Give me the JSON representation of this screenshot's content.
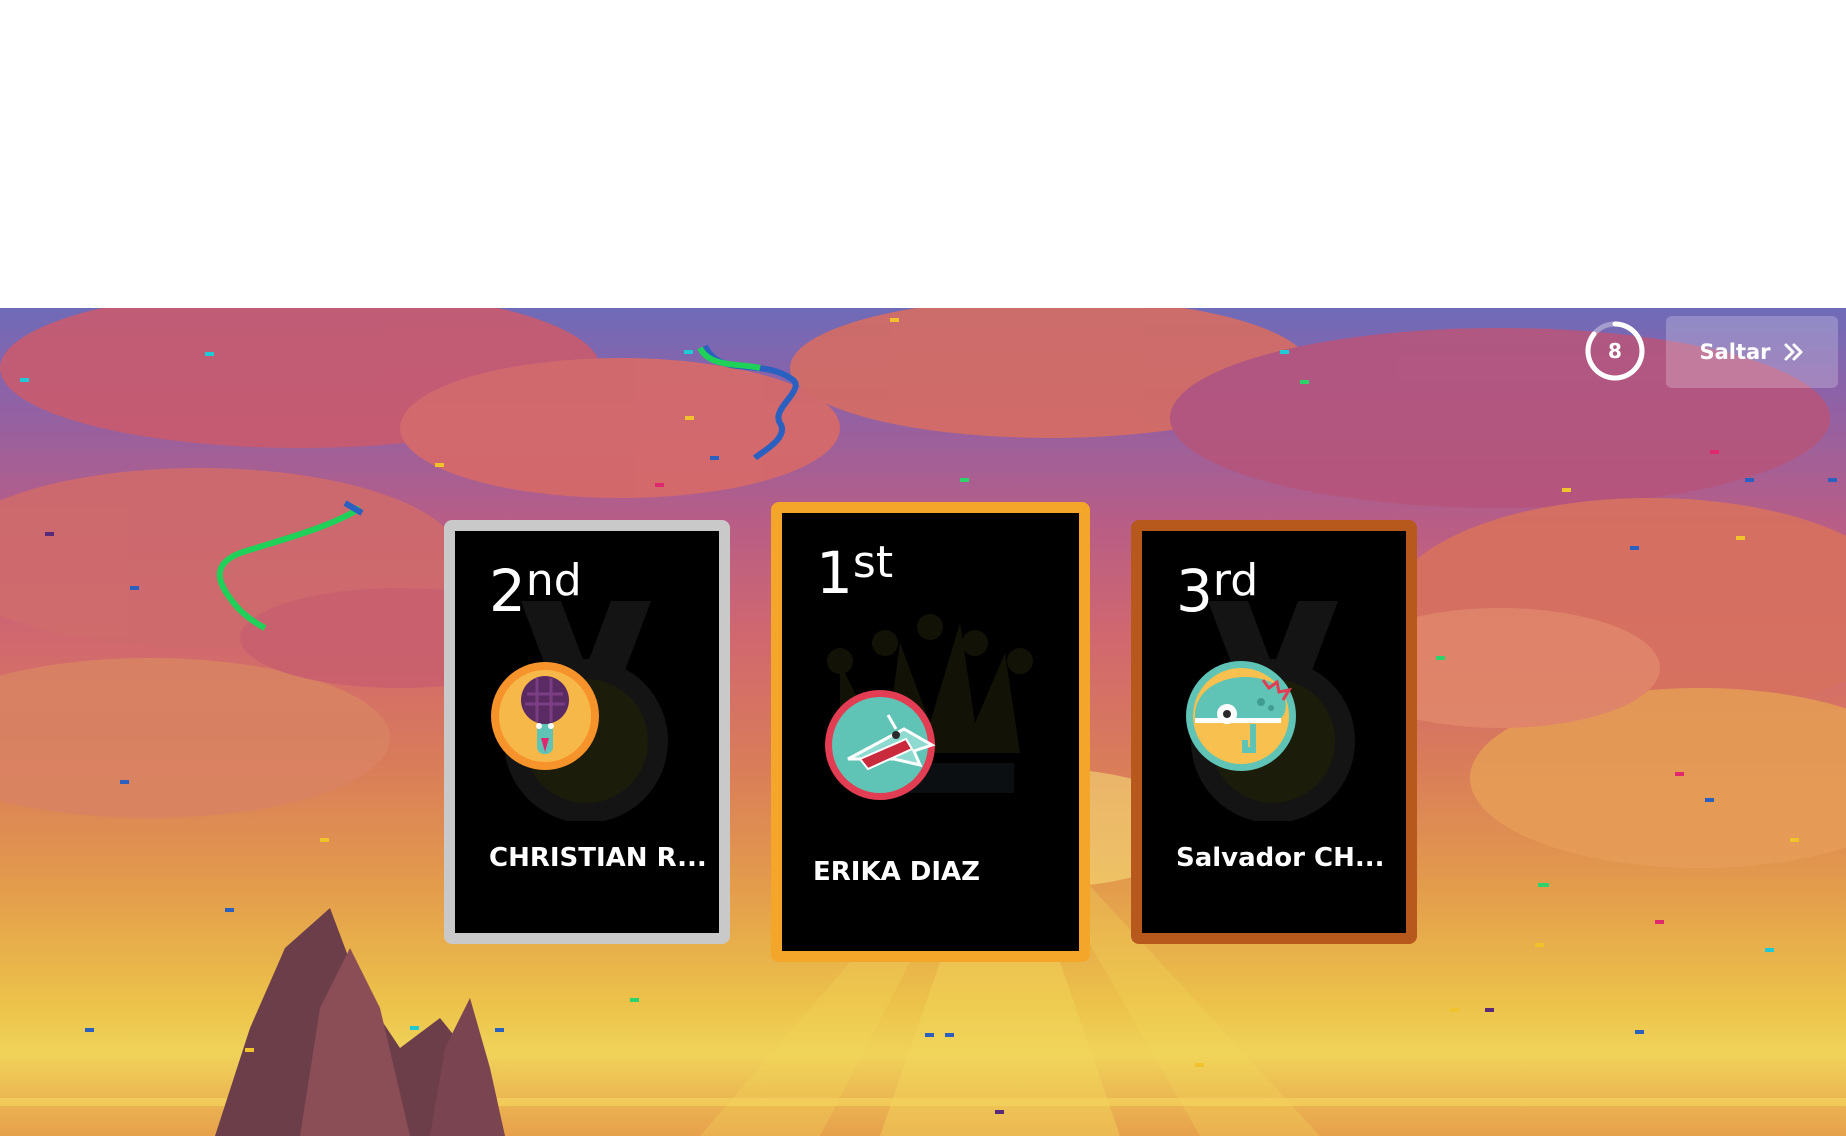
{
  "timer": {
    "value": "8"
  },
  "skip_button": {
    "label": "Saltar",
    "icon": "double-chevron-right-icon"
  },
  "podium": [
    {
      "rank_number": "2",
      "rank_suffix": "nd",
      "player_name": "CHRISTIAN R...",
      "avatar": "microphone-avatar-icon",
      "frame_color": "#c9c9c9"
    },
    {
      "rank_number": "1",
      "rank_suffix": "st",
      "player_name": "ERIKA DIAZ",
      "avatar": "shark-avatar-icon",
      "frame_color": "#f4a62a"
    },
    {
      "rank_number": "3",
      "rank_suffix": "rd",
      "player_name": "Salvador CH...",
      "avatar": "chameleon-avatar-icon",
      "frame_color": "#b7581c"
    }
  ],
  "colors": {
    "gold": "#f4a62a",
    "silver": "#c9c9c9",
    "bronze": "#b7581c",
    "card_bg": "#000000"
  }
}
